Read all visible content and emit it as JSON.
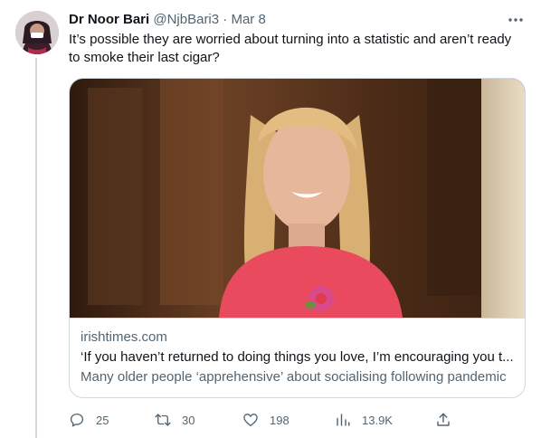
{
  "author": {
    "name": "Dr Noor Bari",
    "handle": "@NjbBari3",
    "separator": "·",
    "date": "Mar 8",
    "avatar_icon": "user-avatar-icon"
  },
  "tweet": {
    "text": "It’s possible they are worried about turning into a statistic and aren’t ready to smoke their last cigar?"
  },
  "card": {
    "domain": "irishtimes.com",
    "title": "‘If you haven’t returned to doing things you love, I’m encouraging you t...",
    "description": "Many older people ‘apprehensive’ about socialising following pandemic",
    "image_icon": "article-photo"
  },
  "actions": {
    "reply_count": "25",
    "retweet_count": "30",
    "like_count": "198",
    "views_count": "13.9K"
  },
  "colors": {
    "text": "#0f1419",
    "secondary": "#536471",
    "border": "#cfd9de"
  }
}
